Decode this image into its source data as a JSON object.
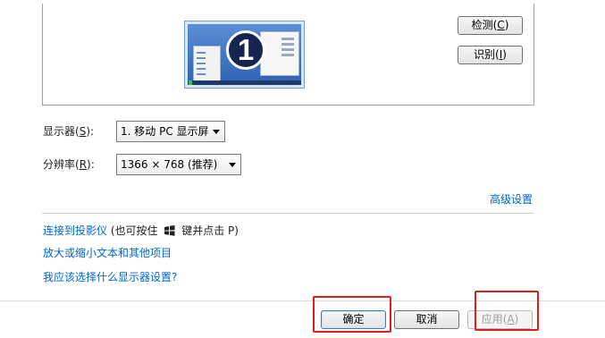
{
  "detect_button": {
    "text": "检测(",
    "key": "C",
    "close": ")"
  },
  "identify_button": {
    "text": "识别(",
    "key": "I",
    "close": ")"
  },
  "display": {
    "label_text": "显示器(",
    "label_key": "S",
    "label_close": "):",
    "value": "1. 移动 PC 显示屏"
  },
  "resolution": {
    "label_text": "分辨率(",
    "label_key": "R",
    "label_close": "):",
    "value": "1366 × 768 (推荐)"
  },
  "monitor_number": "1",
  "advanced_link": "高级设置",
  "projector": {
    "link": "连接到投影仪",
    "hint_before": "(也可按住",
    "hint_after": "键并点击 P)"
  },
  "text_size_link": "放大或缩小文本和其他项目",
  "help_link": "我应该选择什么显示器设置?",
  "ok_button": "确定",
  "cancel_button": "取消",
  "apply_button": {
    "text": "应用(",
    "key": "A",
    "close": ")"
  },
  "colors": {
    "link": "#0066cc",
    "highlight": "#e21c23"
  }
}
